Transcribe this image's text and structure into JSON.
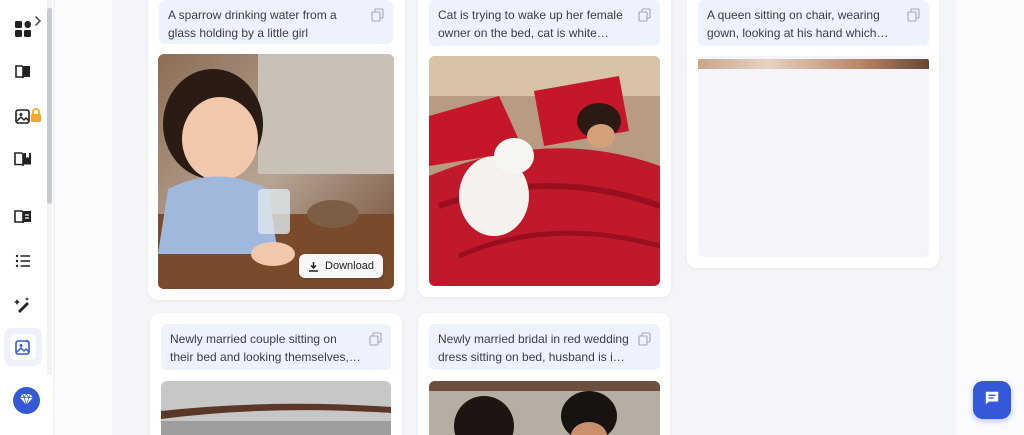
{
  "sidebar": {
    "items": [
      {
        "name": "dashboard-icon"
      },
      {
        "name": "book-icon"
      },
      {
        "name": "image-locked-icon"
      },
      {
        "name": "open-book-icon"
      },
      {
        "name": "reader-icon"
      },
      {
        "name": "list-icon"
      },
      {
        "name": "magic-pen-icon"
      },
      {
        "name": "image-generator-icon"
      }
    ],
    "premium_icon": "diamond-icon"
  },
  "cards": [
    {
      "prompt": "A sparrow drinking water from a glass holding by a little girl",
      "has_download": true
    },
    {
      "prompt": "Cat is trying to wake up her female owner on the bed, cat is white persian and the owner is sleeping"
    },
    {
      "prompt": "A queen sitting on chair, wearing gown, looking at his hand which have ring, beautiful detailed"
    },
    {
      "prompt": "Newly married couple sitting on their bed and looking themselves, in the room full of flowers"
    },
    {
      "prompt": "Newly married bridal in red wedding dress sitting on bed, husband is in sherwani"
    }
  ],
  "download_label": "Download",
  "colors": {
    "accent": "#3458d8",
    "prompt_bg": "#eef2fc",
    "panel_bg": "#f4f5f9"
  }
}
